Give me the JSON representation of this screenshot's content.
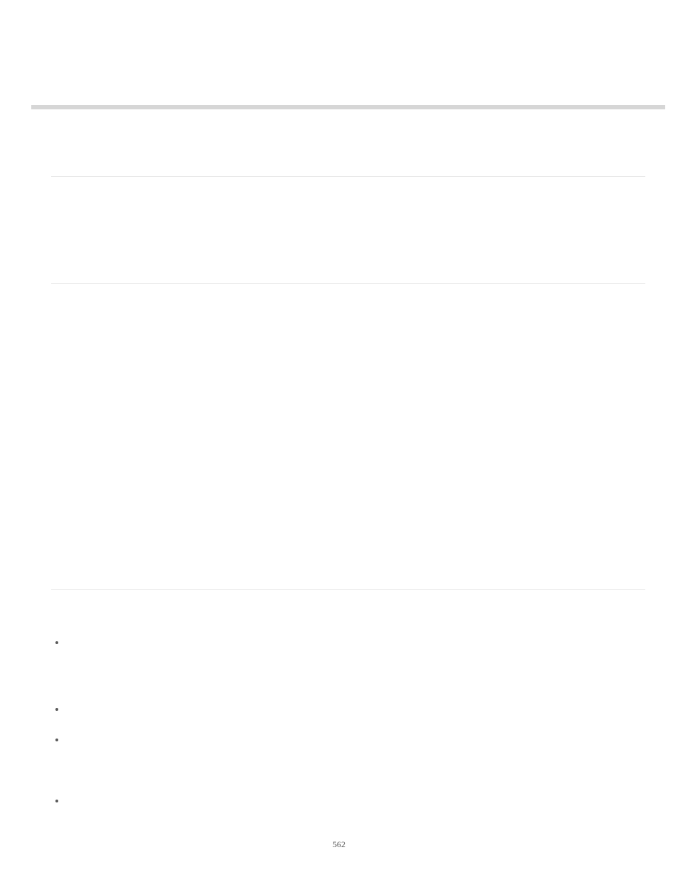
{
  "page_number": "562"
}
